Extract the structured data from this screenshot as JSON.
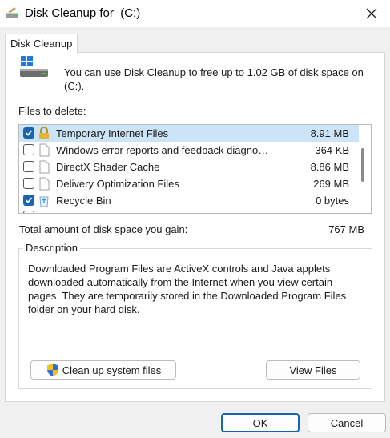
{
  "window": {
    "title": "Disk Cleanup for  (C:)"
  },
  "tab": {
    "label": "Disk Cleanup"
  },
  "intro": {
    "text": "You can use Disk Cleanup to free up to 1.02 GB of disk space on (C:)."
  },
  "files": {
    "label": "Files to delete:",
    "items": [
      {
        "name": "Temporary Internet Files",
        "size": "8.91 MB",
        "checked": true,
        "icon": "lock-icon"
      },
      {
        "name": "Windows error reports and feedback diagnostics",
        "size": "364 KB",
        "checked": false,
        "icon": "file-icon"
      },
      {
        "name": "DirectX Shader Cache",
        "size": "8.86 MB",
        "checked": false,
        "icon": "file-icon"
      },
      {
        "name": "Delivery Optimization Files",
        "size": "269 MB",
        "checked": false,
        "icon": "file-icon"
      },
      {
        "name": "Recycle Bin",
        "size": "0 bytes",
        "checked": true,
        "icon": "recycle-bin-icon"
      }
    ]
  },
  "total": {
    "label": "Total amount of disk space you gain:",
    "value": "767 MB"
  },
  "description": {
    "title": "Description",
    "text": "Downloaded Program Files are ActiveX controls and Java applets downloaded automatically from the Internet when you view certain pages. They are temporarily stored in the Downloaded Program Files folder on your hard disk."
  },
  "buttons": {
    "cleanup_system": "Clean up system files",
    "view_files": "View Files",
    "ok": "OK",
    "cancel": "Cancel"
  },
  "colors": {
    "accent": "#1a64b0",
    "selection": "#cce4f7"
  }
}
